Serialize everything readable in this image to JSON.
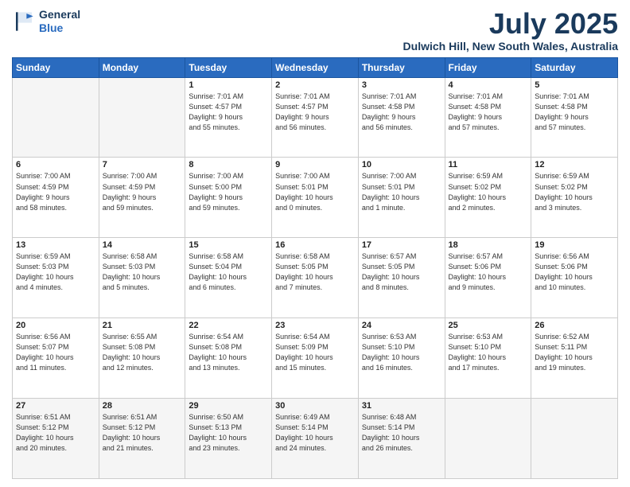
{
  "header": {
    "logo_line1": "General",
    "logo_line2": "Blue",
    "month": "July 2025",
    "location": "Dulwich Hill, New South Wales, Australia"
  },
  "days_of_week": [
    "Sunday",
    "Monday",
    "Tuesday",
    "Wednesday",
    "Thursday",
    "Friday",
    "Saturday"
  ],
  "weeks": [
    [
      {
        "day": "",
        "info": ""
      },
      {
        "day": "",
        "info": ""
      },
      {
        "day": "1",
        "info": "Sunrise: 7:01 AM\nSunset: 4:57 PM\nDaylight: 9 hours\nand 55 minutes."
      },
      {
        "day": "2",
        "info": "Sunrise: 7:01 AM\nSunset: 4:57 PM\nDaylight: 9 hours\nand 56 minutes."
      },
      {
        "day": "3",
        "info": "Sunrise: 7:01 AM\nSunset: 4:58 PM\nDaylight: 9 hours\nand 56 minutes."
      },
      {
        "day": "4",
        "info": "Sunrise: 7:01 AM\nSunset: 4:58 PM\nDaylight: 9 hours\nand 57 minutes."
      },
      {
        "day": "5",
        "info": "Sunrise: 7:01 AM\nSunset: 4:58 PM\nDaylight: 9 hours\nand 57 minutes."
      }
    ],
    [
      {
        "day": "6",
        "info": "Sunrise: 7:00 AM\nSunset: 4:59 PM\nDaylight: 9 hours\nand 58 minutes."
      },
      {
        "day": "7",
        "info": "Sunrise: 7:00 AM\nSunset: 4:59 PM\nDaylight: 9 hours\nand 59 minutes."
      },
      {
        "day": "8",
        "info": "Sunrise: 7:00 AM\nSunset: 5:00 PM\nDaylight: 9 hours\nand 59 minutes."
      },
      {
        "day": "9",
        "info": "Sunrise: 7:00 AM\nSunset: 5:01 PM\nDaylight: 10 hours\nand 0 minutes."
      },
      {
        "day": "10",
        "info": "Sunrise: 7:00 AM\nSunset: 5:01 PM\nDaylight: 10 hours\nand 1 minute."
      },
      {
        "day": "11",
        "info": "Sunrise: 6:59 AM\nSunset: 5:02 PM\nDaylight: 10 hours\nand 2 minutes."
      },
      {
        "day": "12",
        "info": "Sunrise: 6:59 AM\nSunset: 5:02 PM\nDaylight: 10 hours\nand 3 minutes."
      }
    ],
    [
      {
        "day": "13",
        "info": "Sunrise: 6:59 AM\nSunset: 5:03 PM\nDaylight: 10 hours\nand 4 minutes."
      },
      {
        "day": "14",
        "info": "Sunrise: 6:58 AM\nSunset: 5:03 PM\nDaylight: 10 hours\nand 5 minutes."
      },
      {
        "day": "15",
        "info": "Sunrise: 6:58 AM\nSunset: 5:04 PM\nDaylight: 10 hours\nand 6 minutes."
      },
      {
        "day": "16",
        "info": "Sunrise: 6:58 AM\nSunset: 5:05 PM\nDaylight: 10 hours\nand 7 minutes."
      },
      {
        "day": "17",
        "info": "Sunrise: 6:57 AM\nSunset: 5:05 PM\nDaylight: 10 hours\nand 8 minutes."
      },
      {
        "day": "18",
        "info": "Sunrise: 6:57 AM\nSunset: 5:06 PM\nDaylight: 10 hours\nand 9 minutes."
      },
      {
        "day": "19",
        "info": "Sunrise: 6:56 AM\nSunset: 5:06 PM\nDaylight: 10 hours\nand 10 minutes."
      }
    ],
    [
      {
        "day": "20",
        "info": "Sunrise: 6:56 AM\nSunset: 5:07 PM\nDaylight: 10 hours\nand 11 minutes."
      },
      {
        "day": "21",
        "info": "Sunrise: 6:55 AM\nSunset: 5:08 PM\nDaylight: 10 hours\nand 12 minutes."
      },
      {
        "day": "22",
        "info": "Sunrise: 6:54 AM\nSunset: 5:08 PM\nDaylight: 10 hours\nand 13 minutes."
      },
      {
        "day": "23",
        "info": "Sunrise: 6:54 AM\nSunset: 5:09 PM\nDaylight: 10 hours\nand 15 minutes."
      },
      {
        "day": "24",
        "info": "Sunrise: 6:53 AM\nSunset: 5:10 PM\nDaylight: 10 hours\nand 16 minutes."
      },
      {
        "day": "25",
        "info": "Sunrise: 6:53 AM\nSunset: 5:10 PM\nDaylight: 10 hours\nand 17 minutes."
      },
      {
        "day": "26",
        "info": "Sunrise: 6:52 AM\nSunset: 5:11 PM\nDaylight: 10 hours\nand 19 minutes."
      }
    ],
    [
      {
        "day": "27",
        "info": "Sunrise: 6:51 AM\nSunset: 5:12 PM\nDaylight: 10 hours\nand 20 minutes."
      },
      {
        "day": "28",
        "info": "Sunrise: 6:51 AM\nSunset: 5:12 PM\nDaylight: 10 hours\nand 21 minutes."
      },
      {
        "day": "29",
        "info": "Sunrise: 6:50 AM\nSunset: 5:13 PM\nDaylight: 10 hours\nand 23 minutes."
      },
      {
        "day": "30",
        "info": "Sunrise: 6:49 AM\nSunset: 5:14 PM\nDaylight: 10 hours\nand 24 minutes."
      },
      {
        "day": "31",
        "info": "Sunrise: 6:48 AM\nSunset: 5:14 PM\nDaylight: 10 hours\nand 26 minutes."
      },
      {
        "day": "",
        "info": ""
      },
      {
        "day": "",
        "info": ""
      }
    ]
  ]
}
